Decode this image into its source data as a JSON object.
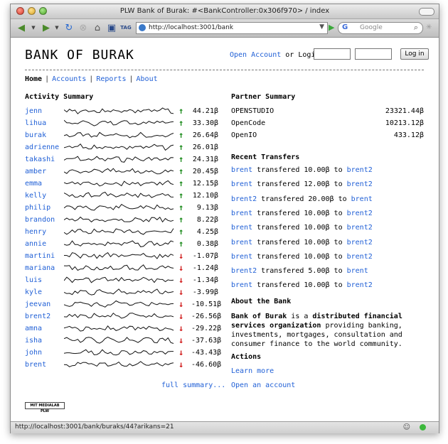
{
  "window": {
    "title": "PLW Bank of Burak: #<BankController:0x306f970> / index"
  },
  "browser": {
    "url": "http://localhost:3001/bank",
    "search_placeholder": "Google",
    "search_engine_glyph": "G",
    "icons": [
      "back-arrow-icon",
      "forward-arrow-icon",
      "refresh-icon",
      "stop-icon",
      "home-icon",
      "bookmark-icon",
      "tag-icon",
      "go-arrow-icon",
      "search-icon"
    ]
  },
  "header": {
    "logo": "BANK OF BURAK",
    "open_account": "Open Account",
    "or_login": "or Login",
    "login_button": "Log in"
  },
  "nav": {
    "items": [
      "Home",
      "Accounts",
      "Reports",
      "About"
    ],
    "active": "Home"
  },
  "activity": {
    "heading": "Activity Summary",
    "rows": [
      {
        "name": "jenn",
        "dir": "up",
        "value": "44.21β"
      },
      {
        "name": "lihua",
        "dir": "up",
        "value": "33.30β"
      },
      {
        "name": "burak",
        "dir": "up",
        "value": "26.64β"
      },
      {
        "name": "adrienne",
        "dir": "up",
        "value": "26.01β"
      },
      {
        "name": "takashi",
        "dir": "up",
        "value": "24.31β"
      },
      {
        "name": "amber",
        "dir": "up",
        "value": "20.45β"
      },
      {
        "name": "emma",
        "dir": "up",
        "value": "12.15β"
      },
      {
        "name": "kelly",
        "dir": "up",
        "value": "12.10β"
      },
      {
        "name": "philip",
        "dir": "up",
        "value": "9.13β"
      },
      {
        "name": "brandon",
        "dir": "up",
        "value": "8.22β"
      },
      {
        "name": "henry",
        "dir": "up",
        "value": "4.25β"
      },
      {
        "name": "annie",
        "dir": "up",
        "value": "0.38β"
      },
      {
        "name": "martini",
        "dir": "down",
        "value": "-1.07β"
      },
      {
        "name": "mariana",
        "dir": "down",
        "value": "-1.24β"
      },
      {
        "name": "luis",
        "dir": "down",
        "value": "-1.34β"
      },
      {
        "name": "kyle",
        "dir": "down",
        "value": "-3.99β"
      },
      {
        "name": "jeevan",
        "dir": "down",
        "value": "-10.51β"
      },
      {
        "name": "brent2",
        "dir": "down",
        "value": "-26.56β"
      },
      {
        "name": "amna",
        "dir": "down",
        "value": "-29.22β"
      },
      {
        "name": "isha",
        "dir": "down",
        "value": "-37.63β"
      },
      {
        "name": "john",
        "dir": "down",
        "value": "-43.43β"
      },
      {
        "name": "brent",
        "dir": "down",
        "value": "-46.60β"
      }
    ],
    "full_summary": "full summary..."
  },
  "partners": {
    "heading": "Partner Summary",
    "rows": [
      {
        "name": "OPENSTUDIO",
        "value": "23321.44β"
      },
      {
        "name": "OpenCode",
        "value": "10213.12β"
      },
      {
        "name": "OpenIO",
        "value": "433.12β"
      }
    ]
  },
  "transfers": {
    "heading": "Recent Transfers",
    "verb": "transfered",
    "to": "to",
    "rows": [
      {
        "from": "brent",
        "amount": "10.00β",
        "to": "brent2"
      },
      {
        "from": "brent",
        "amount": "12.00β",
        "to": "brent2"
      },
      {
        "from": "brent2",
        "amount": "20.00β",
        "to": "brent"
      },
      {
        "from": "brent",
        "amount": "10.00β",
        "to": "brent2"
      },
      {
        "from": "brent",
        "amount": "10.00β",
        "to": "brent2"
      },
      {
        "from": "brent",
        "amount": "10.00β",
        "to": "brent2"
      },
      {
        "from": "brent",
        "amount": "10.00β",
        "to": "brent2"
      },
      {
        "from": "brent2",
        "amount": "5.00β",
        "to": "brent"
      },
      {
        "from": "brent",
        "amount": "10.00β",
        "to": "brent2"
      }
    ]
  },
  "about": {
    "heading": "About the Bank",
    "bank_name": "Bank of Burak",
    "is_a": " is a ",
    "emphasis": "distributed financial services organization",
    "rest": " providing banking, investments, mortgages, consultation and consumer finance to the world community."
  },
  "actions": {
    "heading": "Actions",
    "items": [
      "Learn more",
      "Open an account"
    ]
  },
  "footer": {
    "badge": "MIT MEDIALAB PLW"
  },
  "status": {
    "text": "http://localhost:3001/bank/buraks/44?arikans=21"
  },
  "colors": {
    "link": "#1f5fd6",
    "up_arrow": "#1a8a1a",
    "down_arrow": "#d01818"
  }
}
